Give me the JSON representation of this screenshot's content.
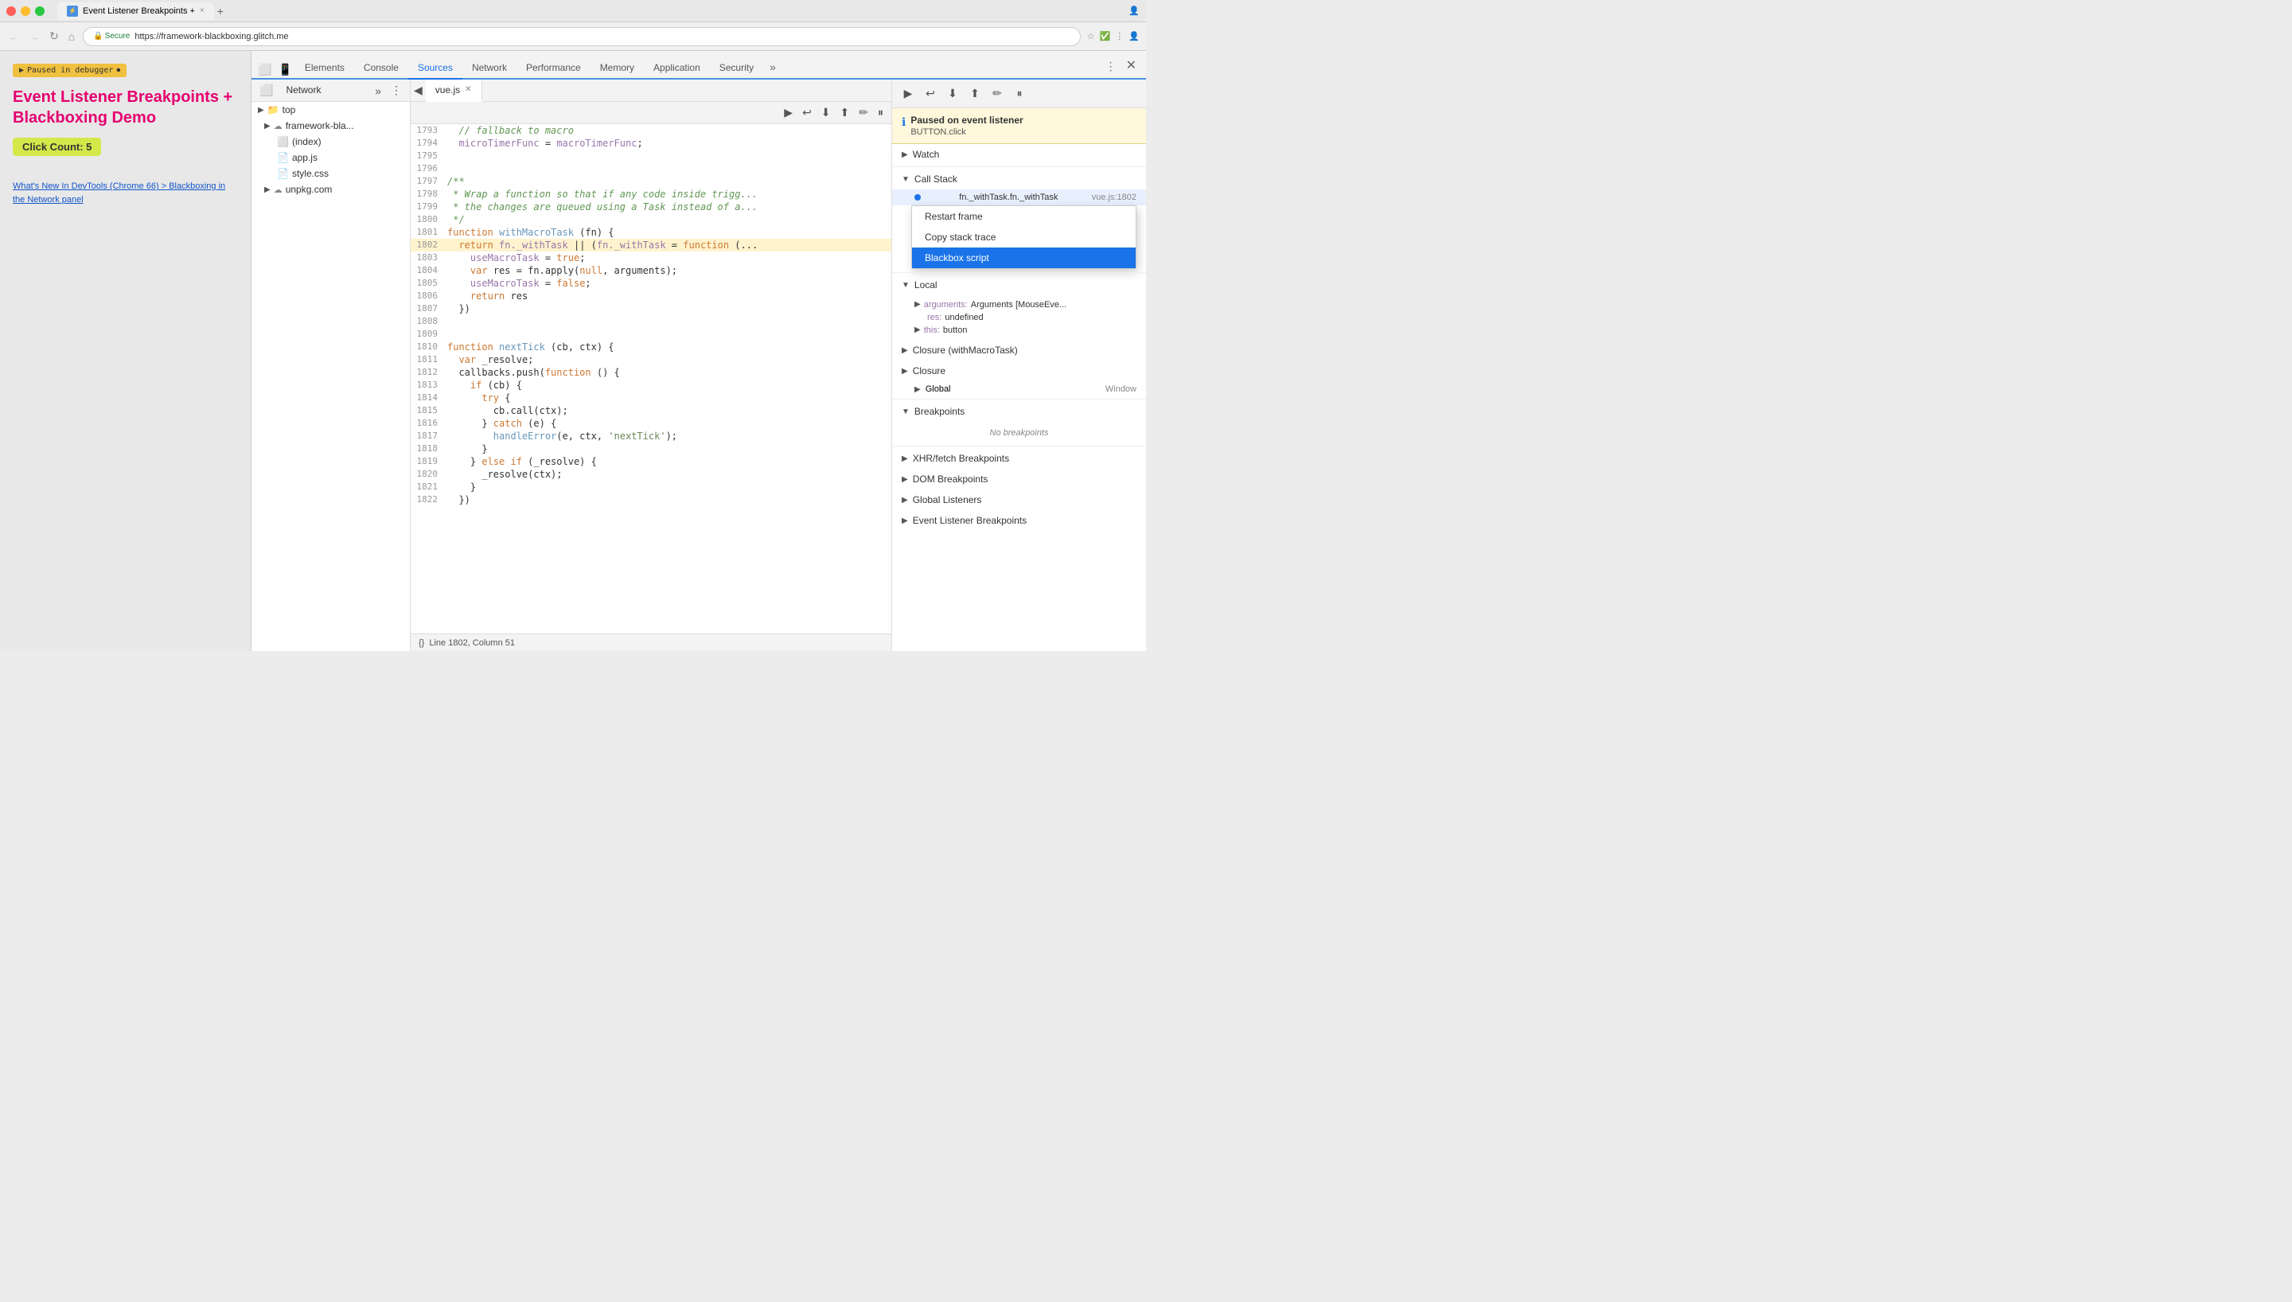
{
  "titleBar": {
    "tab": {
      "label": "Event Listener Breakpoints +",
      "close": "×"
    },
    "newTabIcon": "+"
  },
  "addressBar": {
    "secure": "Secure",
    "url": "https://framework-blackboxing.glitch.me",
    "personIcon": "👤"
  },
  "page": {
    "pausedBadge": "Paused in debugger",
    "title": "Event Listener Breakpoints + Blackboxing Demo",
    "clickCount": "Click Count: 5",
    "link1": "What's New In DevTools (Chrome 66) > Blackboxing in the Network panel"
  },
  "devtools": {
    "tabs": [
      "Elements",
      "Console",
      "Sources",
      "Network",
      "Performance",
      "Memory",
      "Application",
      "Security"
    ],
    "activeTab": "Sources",
    "moreLabel": "»",
    "menuLabel": "⋮",
    "closeLabel": "×"
  },
  "fileTree": {
    "networkLabel": "Network",
    "moreLabel": "»",
    "menuLabel": "⋮",
    "items": [
      {
        "indent": 0,
        "arrow": "▶",
        "icon": "folder",
        "name": "top"
      },
      {
        "indent": 1,
        "arrow": "▶",
        "icon": "cloud",
        "name": "framework-bla..."
      },
      {
        "indent": 2,
        "arrow": "",
        "icon": "html",
        "name": "(index)"
      },
      {
        "indent": 2,
        "arrow": "",
        "icon": "js",
        "name": "app.js"
      },
      {
        "indent": 2,
        "arrow": "",
        "icon": "css",
        "name": "style.css"
      },
      {
        "indent": 1,
        "arrow": "▶",
        "icon": "cloud",
        "name": "unpkg.com"
      }
    ]
  },
  "editor": {
    "tab": "vue.js",
    "lines": [
      {
        "num": 1793,
        "text": "  // fallback to macro",
        "type": "comment"
      },
      {
        "num": 1794,
        "text": "  microTimerFunc = macroTimerFunc;",
        "type": "code"
      },
      {
        "num": 1795,
        "text": "",
        "type": "code"
      },
      {
        "num": 1796,
        "text": "",
        "type": "code"
      },
      {
        "num": 1797,
        "text": "/**",
        "type": "comment"
      },
      {
        "num": 1798,
        "text": " * Wrap a function so that if any code inside trigg...",
        "type": "comment"
      },
      {
        "num": 1799,
        "text": " * the changes are queued using a Task instead of a...",
        "type": "comment"
      },
      {
        "num": 1800,
        "text": " */",
        "type": "comment"
      },
      {
        "num": 1801,
        "text": "function withMacroTask (fn) {",
        "type": "code"
      },
      {
        "num": 1802,
        "text": "  return fn._withTask || (fn._withTask = function (...",
        "type": "highlighted"
      },
      {
        "num": 1803,
        "text": "    useMacroTask = true;",
        "type": "code"
      },
      {
        "num": 1804,
        "text": "    var res = fn.apply(null, arguments);",
        "type": "code"
      },
      {
        "num": 1805,
        "text": "    useMacroTask = false;",
        "type": "code"
      },
      {
        "num": 1806,
        "text": "    return res",
        "type": "code"
      },
      {
        "num": 1807,
        "text": "  })",
        "type": "code"
      },
      {
        "num": 1808,
        "text": "",
        "type": "code"
      },
      {
        "num": 1809,
        "text": "",
        "type": "code"
      },
      {
        "num": 1810,
        "text": "function nextTick (cb, ctx) {",
        "type": "code"
      },
      {
        "num": 1811,
        "text": "  var _resolve;",
        "type": "code"
      },
      {
        "num": 1812,
        "text": "  callbacks.push(function () {",
        "type": "code"
      },
      {
        "num": 1813,
        "text": "    if (cb) {",
        "type": "code"
      },
      {
        "num": 1814,
        "text": "      try {",
        "type": "code"
      },
      {
        "num": 1815,
        "text": "        cb.call(ctx);",
        "type": "code"
      },
      {
        "num": 1816,
        "text": "      } catch (e) {",
        "type": "code"
      },
      {
        "num": 1817,
        "text": "        handleError(e, ctx, 'nextTick');",
        "type": "code"
      },
      {
        "num": 1818,
        "text": "      }",
        "type": "code"
      },
      {
        "num": 1819,
        "text": "    } else if (_resolve) {",
        "type": "code"
      },
      {
        "num": 1820,
        "text": "      _resolve(ctx);",
        "type": "code"
      },
      {
        "num": 1821,
        "text": "    }",
        "type": "code"
      },
      {
        "num": 1822,
        "text": "  })",
        "type": "code"
      }
    ],
    "status": "Line 1802, Column 51"
  },
  "debugPanel": {
    "pausedTitle": "Paused on event listener",
    "pausedSub": "BUTTON.click",
    "sections": {
      "watch": "Watch",
      "callStack": "Call Stack",
      "scope": {
        "local": "Local",
        "closure1": "Closure (withMacroTask)",
        "closure2": "Closure",
        "global": "Global",
        "globalVal": "Window"
      },
      "breakpoints": "Breakpoints",
      "noBreakpoints": "No breakpoints",
      "xhrBreakpoints": "XHR/fetch Breakpoints",
      "domBreakpoints": "DOM Breakpoints",
      "globalListeners": "Global Listeners",
      "eventListenerBreakpoints": "Event Listener Breakpoints"
    },
    "callStackItems": [
      {
        "name": "fn._withTask.fn._withTask",
        "loc": "vue.js:1802"
      }
    ],
    "contextMenu": {
      "items": [
        "Restart frame",
        "Copy stack trace",
        "Blackbox script"
      ],
      "activeItem": "Blackbox script"
    },
    "localScope": [
      {
        "key": "arguments:",
        "val": "Arguments [MouseEve..."
      },
      {
        "key": "res:",
        "val": "undefined"
      },
      {
        "key": "this:",
        "val": "button"
      }
    ]
  }
}
